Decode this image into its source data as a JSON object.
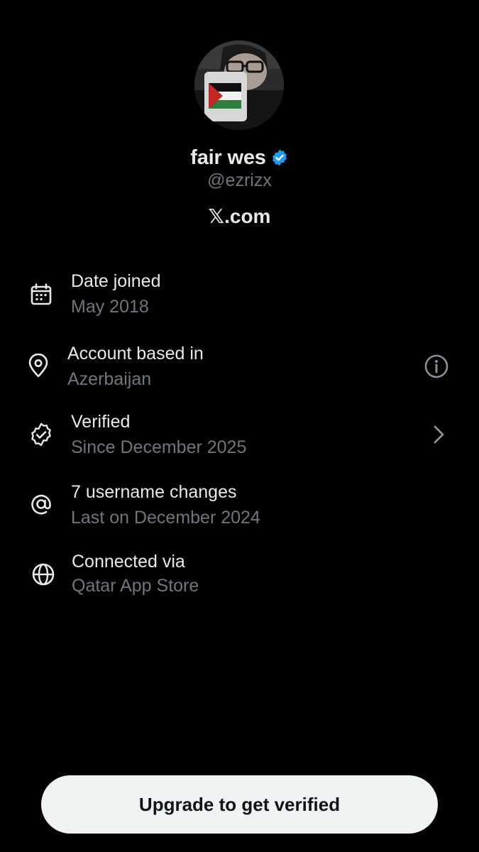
{
  "profile": {
    "display_name": "fair wes",
    "handle": "@ezrizx",
    "platform": "𝕏.com",
    "badge_icon": "verified-badge-icon",
    "accent_color": "#1d9bf0"
  },
  "info_items": [
    {
      "icon": "calendar-icon",
      "title": "Date joined",
      "value": "May 2018"
    },
    {
      "icon": "location-pin-icon",
      "title": "Account based in",
      "value": "Azerbaijan",
      "trailing_icon": "info-icon"
    },
    {
      "icon": "verified-check-icon",
      "title": "Verified",
      "value": "Since December 2025",
      "trailing_icon": "chevron-right-icon"
    },
    {
      "icon": "at-sign-icon",
      "title": "7 username changes",
      "value": "Last on December 2024"
    },
    {
      "icon": "globe-icon",
      "title": "Connected via",
      "value": "Qatar App Store"
    }
  ],
  "cta": {
    "label": "Upgrade to get verified"
  }
}
